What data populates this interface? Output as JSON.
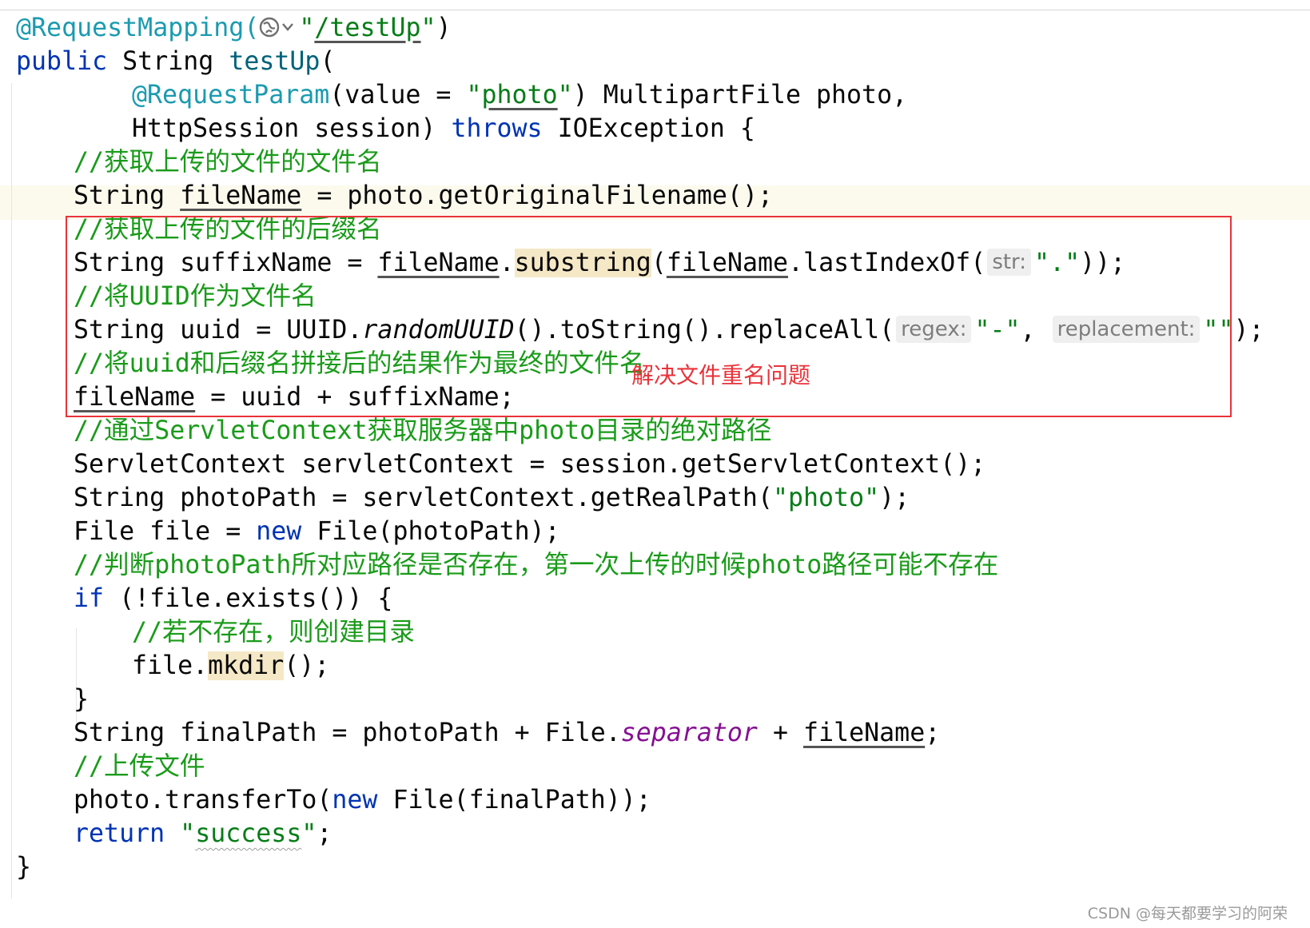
{
  "annotation_note": "解决文件重名问题",
  "watermark": "CSDN @每天都要学习的阿荣",
  "code": {
    "l1_ann": "@RequestMapping(",
    "l1_str_q1": "\"",
    "l1_str": "/testUp",
    "l1_str_q2": "\"",
    "l1_end": ")",
    "l2_kw": "public",
    "l2_rest1": " String ",
    "l2_fn": "testUp",
    "l2_rest2": "(",
    "l3_ann": "@RequestParam",
    "l3_a": "(value = ",
    "l3_str_q1": "\"",
    "l3_str": "photo",
    "l3_str_q2": "\"",
    "l3_b": ") MultipartFile photo,",
    "l4_a": "HttpSession session) ",
    "l4_kw": "throws",
    "l4_b": " IOException {",
    "l5_cm": "//获取上传的文件的文件名",
    "l6_a": "String ",
    "l6_var": "fileName",
    "l6_b": " = photo.getOriginalFilename();",
    "l7_cm": "//获取上传的文件的后缀名",
    "l8_a": "String suffixName = ",
    "l8_var": "fileName",
    "l8_dot": ".",
    "l8_hl": "substring",
    "l8_p": "(",
    "l8_var2": "fileName",
    "l8_b": ".lastIndexOf(",
    "l8_hint": "str:",
    "l8_str": "\".\"",
    "l8_c": "));",
    "l9_cm": "//将UUID作为文件名",
    "l10_a": "String uuid = UUID.",
    "l10_it": "randomUUID",
    "l10_b": "().toString().replaceAll(",
    "l10_hint1": "regex:",
    "l10_str1": "\"-\"",
    "l10_c": ", ",
    "l10_hint2": "replacement:",
    "l10_str2": "\"\"",
    "l10_d": ");",
    "l11_cm": "//将uuid和后缀名拼接后的结果作为最终的文件名",
    "l12_var": "fileName",
    "l12_b": " = uuid + suffixName;",
    "l13_cm": "//通过ServletContext获取服务器中photo目录的绝对路径",
    "l14": "ServletContext servletContext = session.getServletContext();",
    "l15_a": "String photoPath = servletContext.getRealPath(",
    "l15_str": "\"photo\"",
    "l15_b": ");",
    "l16_a": "File file = ",
    "l16_kw": "new",
    "l16_b": " File(photoPath);",
    "l17_cm": "//判断photoPath所对应路径是否存在，第一次上传的时候photo路径可能不存在",
    "l18_kw": "if",
    "l18_b": " (!file.exists()) {",
    "l19_cm": "//若不存在，则创建目录",
    "l20_a": "file.",
    "l20_hl": "mkdir",
    "l20_b": "();",
    "l21": "}",
    "l22_a": "String finalPath = photoPath + File.",
    "l22_st": "separator",
    "l22_b": " + ",
    "l22_var": "fileName",
    "l22_c": ";",
    "l23_cm": "//上传文件",
    "l24_a": "photo.transferTo(",
    "l24_kw": "new",
    "l24_b": " File(finalPath));",
    "l25_kw": "return",
    "l25_sp": " ",
    "l25_q1": "\"",
    "l25_str": "success",
    "l25_q2": "\"",
    "l25_b": ";",
    "l26": "}"
  }
}
